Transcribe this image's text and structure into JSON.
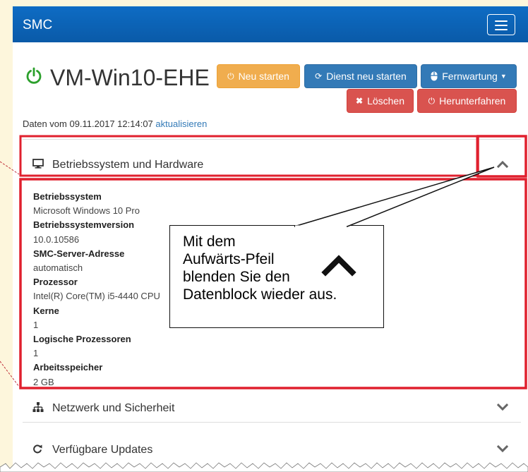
{
  "navbar": {
    "brand": "SMC"
  },
  "header": {
    "title": "VM-Win10-EHE",
    "buttons": {
      "restart": "Neu starten",
      "restart_service": "Dienst neu starten",
      "remote": "Fernwartung",
      "delete": "Löschen",
      "shutdown": "Herunterfahren"
    }
  },
  "data_info": {
    "text": "Daten vom 09.11.2017 12:14:07 ",
    "refresh_link": "aktualisieren"
  },
  "panels": {
    "os_hw": {
      "title": "Betriebssystem und Hardware",
      "fields": [
        {
          "label": "Betriebssystem",
          "value": "Microsoft Windows 10 Pro"
        },
        {
          "label": "Betriebssystemversion",
          "value": "10.0.10586"
        },
        {
          "label": "SMC-Server-Adresse",
          "value": "automatisch"
        },
        {
          "label": "Prozessor",
          "value": "Intel(R) Core(TM) i5-4440 CPU"
        },
        {
          "label": "Kerne",
          "value": "1"
        },
        {
          "label": "Logische Prozessoren",
          "value": "1"
        },
        {
          "label": "Arbeitsspeicher",
          "value": "2 GB"
        }
      ]
    },
    "network": {
      "title": "Netzwerk und Sicherheit"
    },
    "updates": {
      "title": "Verfügbare Updates"
    }
  },
  "callout": {
    "text": "Mit dem\nAufwärts-Pfeil\nblenden Sie  den\nDatenblock wieder aus."
  },
  "colors": {
    "navbar": "#0a5aa8",
    "success": "#2ca02c",
    "warning": "#f0ad4e",
    "primary": "#337ab7",
    "danger": "#d9534f",
    "highlight": "#e0202e"
  }
}
